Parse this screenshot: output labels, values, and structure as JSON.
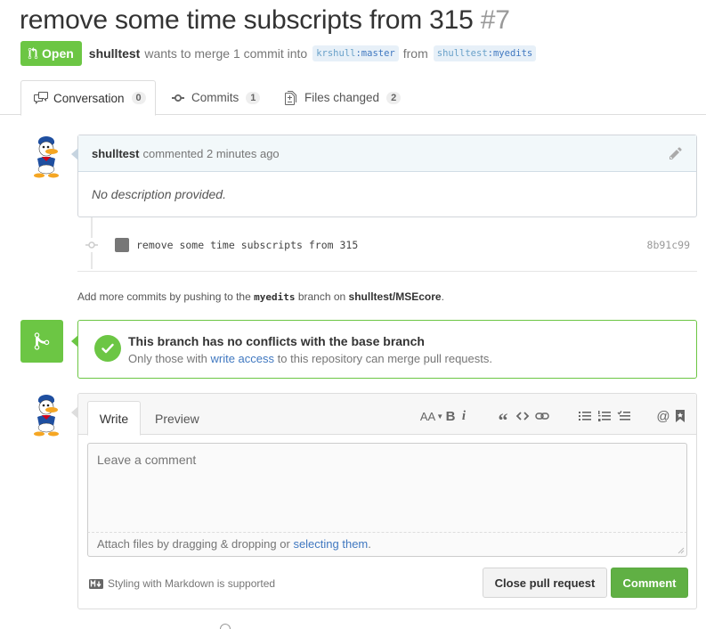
{
  "pr": {
    "title": "remove some time subscripts from 315",
    "number": "#7",
    "state": "Open",
    "author": "shulltest",
    "merge_text": "wants to merge 1 commit into",
    "base_ref_user": "krshull",
    "base_ref_branch": ":master",
    "from_text": "from",
    "head_ref_user": "shulltest",
    "head_ref_branch": ":myedits"
  },
  "tabs": [
    {
      "label": "Conversation",
      "count": "0",
      "icon": "comment-discussion-icon"
    },
    {
      "label": "Commits",
      "count": "1",
      "icon": "commit-icon"
    },
    {
      "label": "Files changed",
      "count": "2",
      "icon": "diff-icon"
    }
  ],
  "comment": {
    "author": "shulltest",
    "meta": "commented 2 minutes ago",
    "body": "No description provided."
  },
  "commit": {
    "message": "remove some time subscripts from 315",
    "sha": "8b91c99"
  },
  "hint": {
    "prefix": "Add more commits by pushing to the",
    "branch": "myedits",
    "middle": "branch on",
    "repo": "shulltest/MSEcore",
    "suffix": "."
  },
  "merge": {
    "title": "This branch has no conflicts with the base branch",
    "sub_prefix": "Only those with",
    "sub_link": "write access",
    "sub_suffix": "to this repository can merge pull requests."
  },
  "form": {
    "write_tab": "Write",
    "preview_tab": "Preview",
    "placeholder": "Leave a comment",
    "attach_prefix": "Attach files by dragging & dropping or",
    "attach_link": "selecting them",
    "attach_suffix": ".",
    "markdown_note": "Styling with Markdown is supported",
    "close_button": "Close pull request",
    "comment_button": "Comment",
    "toolbar_heading": "AA",
    "toolbar_bold": "B",
    "toolbar_italic": "i",
    "toolbar_quote": "“",
    "toolbar_mention": "@"
  },
  "colors": {
    "open_green": "#6cc644",
    "link_blue": "#4078c0",
    "comment_button": "#60b044"
  }
}
